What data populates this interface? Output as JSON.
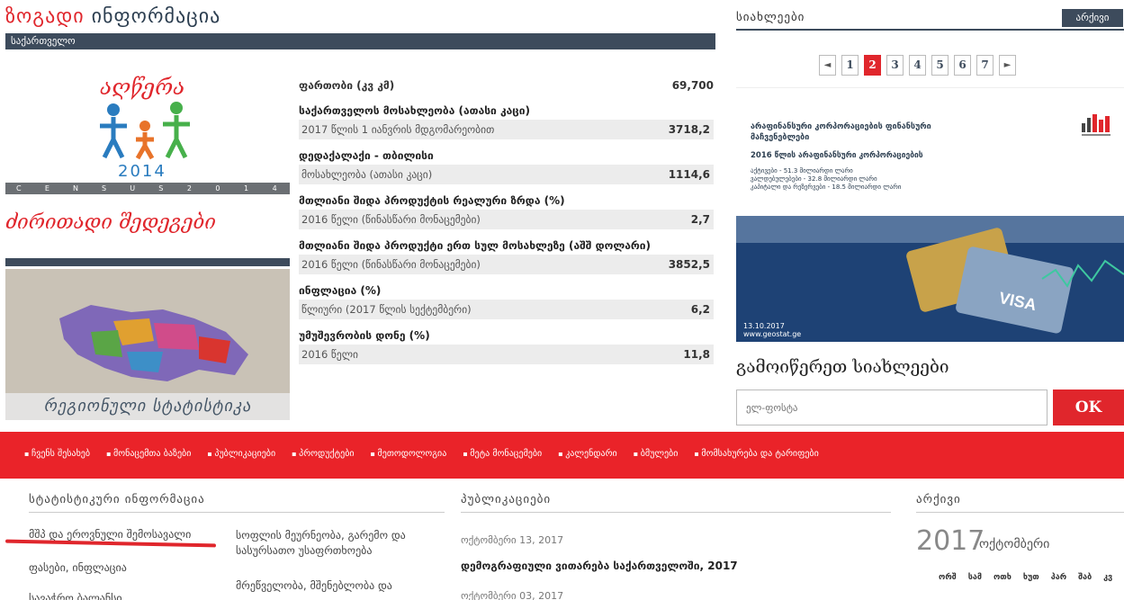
{
  "general": {
    "title_part1": "ზოგადი",
    "title_part2": "ინფორმაცია",
    "subtitle": "საქართველო"
  },
  "census": {
    "word": "აღწერა",
    "year": "2014",
    "strip_letters": [
      "C",
      "E",
      "N",
      "S",
      "U",
      "S",
      "2",
      "0",
      "1",
      "4"
    ],
    "results_label": "ძირითადი შედეგები"
  },
  "region": {
    "label": "რეგიონული სტატისტიკა"
  },
  "stats": [
    {
      "title": "ფართობი (კვ კმ)",
      "value": "69,700"
    },
    {
      "title": "საქართველოს მოსახლეობა (ათასი კაცი)",
      "sub": "2017 წლის 1 იანვრის მდგომარეობით",
      "value": "3718,2"
    },
    {
      "title": "დედაქალაქი - თბილისი",
      "sub": "მოსახლეობა (ათასი კაცი)",
      "value": "1114,6"
    },
    {
      "title": "მთლიანი შიდა პროდუქტის რეალური ზრდა (%)",
      "sub": "2016 წელი (წინასწარი მონაცემები)",
      "value": "2,7"
    },
    {
      "title": "მთლიანი შიდა პროდუქტი ერთ სულ მოსახლეზე (აშშ დოლარი)",
      "sub": "2016 წელი (წინასწარი მონაცემები)",
      "value": "3852,5"
    },
    {
      "title": "ინფლაცია (%)",
      "sub": "წლიური (2017 წლის სექტემბერი)",
      "value": "6,2"
    },
    {
      "title": "უმუშევრობის დონე (%)",
      "sub": "2016 წელი",
      "value": "11,8"
    }
  ],
  "news": {
    "title": "სიახლეები",
    "archive": "არქივი",
    "pages": [
      "1",
      "2",
      "3",
      "4",
      "5",
      "6",
      "7"
    ],
    "active_page": "2",
    "prev": "◄",
    "next": "►",
    "banner1_head": "არაფინანსური კორპორაციების ფინანსური მაჩვენებლები",
    "banner1_date": "2016 წლის არაფინანსური კორპორაციების",
    "banner1_lines": [
      "აქტივები - 51.3 მილიარდი ლარი",
      "ვალდებულებები - 32.8 მილიარდი ლარი",
      "კაპიტალი და რეზერვები - 18.5 მილიარდი ლარი"
    ],
    "banner2_date": "13.10.2017",
    "banner2_url": "www.geostat.ge"
  },
  "subscribe": {
    "title": "გამოიწერეთ სიახლეები",
    "placeholder": "ელ-ფოსტა",
    "button": "OK"
  },
  "nav": [
    "ჩვენს შესახებ",
    "მონაცემთა ბაზები",
    "პუბლიკაციები",
    "პროდუქტები",
    "მეთოდოლოგია",
    "მეტა მონაცემები",
    "კალენდარი",
    "ბმულები",
    "მომსახურება და ტარიფები"
  ],
  "bottom": {
    "stat_head": "სტატისტიკური ინფორმაცია",
    "pub_head": "პუბლიკაციები",
    "arch_head": "არქივი",
    "links_col1": [
      "მშპ და ეროვნული შემოსავალი",
      "ფასები, ინფლაცია",
      "სავაჭრო ბალანსი"
    ],
    "links_col2": [
      "სოფლის მეურნეობა, გარემო და სასურსათო უსაფრთხოება",
      "მრეწველობა, მშენებლობა და"
    ],
    "pub_date1": "ოქტომბერი 13, 2017",
    "pub_title1": "დემოგრაფიული ვითარება საქართველოში, 2017",
    "pub_date2": "ოქტომბერი 03, 2017",
    "arch_year": "2017",
    "arch_month": "ოქტომბერი",
    "weekdays": [
      "ორშ",
      "სამ",
      "ოთხ",
      "ხუთ",
      "პარ",
      "შაბ",
      "კვ"
    ]
  },
  "colors": {
    "brand_red": "#e0262c",
    "navy": "#3d4b5c"
  }
}
